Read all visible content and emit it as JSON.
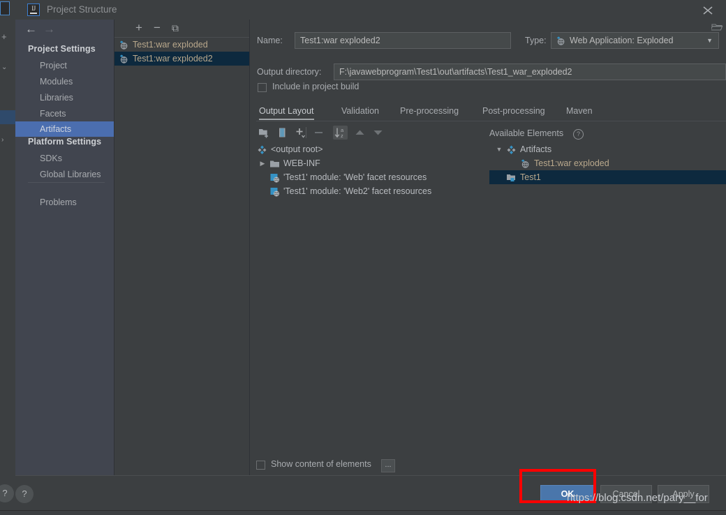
{
  "window": {
    "title": "Project Structure",
    "app_icon": "IJ",
    "close_icon": "close-icon"
  },
  "nav": {
    "back_icon": "arrow-left-icon",
    "forward_icon": "arrow-right-icon"
  },
  "sidebar": {
    "groups": [
      {
        "title": "Project Settings",
        "items": [
          {
            "label": "Project",
            "selected": false
          },
          {
            "label": "Modules",
            "selected": false
          },
          {
            "label": "Libraries",
            "selected": false
          },
          {
            "label": "Facets",
            "selected": false
          },
          {
            "label": "Artifacts",
            "selected": true
          }
        ]
      },
      {
        "title": "Platform Settings",
        "items": [
          {
            "label": "SDKs",
            "selected": false
          },
          {
            "label": "Global Libraries",
            "selected": false
          }
        ]
      }
    ],
    "problems": {
      "label": "Problems",
      "selected": false
    }
  },
  "artifacts_panel": {
    "toolbar": [
      {
        "name": "add-artifact-button",
        "glyph": "+"
      },
      {
        "name": "remove-artifact-button",
        "glyph": "−"
      },
      {
        "name": "copy-artifact-button",
        "glyph": "⧉"
      }
    ],
    "items": [
      {
        "label": "Test1:war exploded",
        "selected": false,
        "icon": "artifact-web-icon"
      },
      {
        "label": "Test1:war exploded2",
        "selected": true,
        "icon": "artifact-web-icon"
      }
    ]
  },
  "editor": {
    "name_label": "Name:",
    "name_value": "Test1:war exploded2",
    "type_label": "Type:",
    "type_value": "Web Application: Exploded",
    "type_icon": "artifact-web-icon",
    "type_arrow": "chevron-down-icon",
    "output_dir_label": "Output directory:",
    "output_dir_value": "F:\\javawebprogram\\Test1\\out\\artifacts\\Test1_war_exploded2",
    "browse_icon": "folder-open-icon",
    "include_in_build_label": "Include in project build",
    "include_in_build_checked": false,
    "tabs": [
      {
        "label": "Output Layout",
        "active": true
      },
      {
        "label": "Validation",
        "active": false
      },
      {
        "label": "Pre-processing",
        "active": false
      },
      {
        "label": "Post-processing",
        "active": false
      },
      {
        "label": "Maven",
        "active": false
      }
    ]
  },
  "layout_toolbar": [
    {
      "name": "create-directory-button",
      "icon": "folder-add-icon",
      "active": false
    },
    {
      "name": "create-archive-button",
      "icon": "archive-icon",
      "active": false
    },
    {
      "name": "add-copy-button",
      "icon": "plus-dropdown-icon",
      "active": false
    },
    {
      "name": "remove-element-button",
      "icon": "minus-icon",
      "active": false
    },
    {
      "name": "sort-button",
      "icon": "sort-az-icon",
      "active": true
    },
    {
      "name": "move-up-button",
      "icon": "arrow-up-icon",
      "active": false
    },
    {
      "name": "move-down-button",
      "icon": "arrow-down-icon",
      "active": false
    }
  ],
  "output_layout_tree": [
    {
      "label": "<output root>",
      "indent": 0,
      "icon": "output-root-icon",
      "expander": "none",
      "selected": false,
      "style": "plain"
    },
    {
      "label": "WEB-INF",
      "indent": 0,
      "icon": "folder-icon",
      "expander": "collapsed",
      "selected": false,
      "style": "plain"
    },
    {
      "label": "'Test1' module: 'Web' facet resources",
      "indent": 1,
      "icon": "facet-resource-icon",
      "expander": "none",
      "selected": false,
      "style": "plain"
    },
    {
      "label": "'Test1' module: 'Web2' facet resources",
      "indent": 1,
      "icon": "facet-resource-icon",
      "expander": "none",
      "selected": false,
      "style": "plain"
    }
  ],
  "available_elements": {
    "header": "Available Elements",
    "help_icon": "question-circle-icon",
    "tree": [
      {
        "label": "Artifacts",
        "indent": 0,
        "icon": "output-root-icon",
        "expander": "expanded",
        "selected": false,
        "style": "plain"
      },
      {
        "label": "Test1:war exploded",
        "indent": 1,
        "icon": "artifact-web-icon",
        "expander": "none",
        "selected": false,
        "style": "artifact"
      },
      {
        "label": "Test1",
        "indent": 0,
        "icon": "module-icon",
        "expander": "none",
        "selected": true,
        "style": "artifact"
      }
    ]
  },
  "show_content": {
    "label": "Show content of elements",
    "checked": false,
    "more_button": "..."
  },
  "footer": {
    "help_icon": "?",
    "ok_label": "OK",
    "cancel_label": "Cancel",
    "apply_label": "Apply"
  },
  "annotation": {
    "highlight_color": "#ff0000",
    "watermark": "https://blog.csdn.net/pary__for"
  }
}
